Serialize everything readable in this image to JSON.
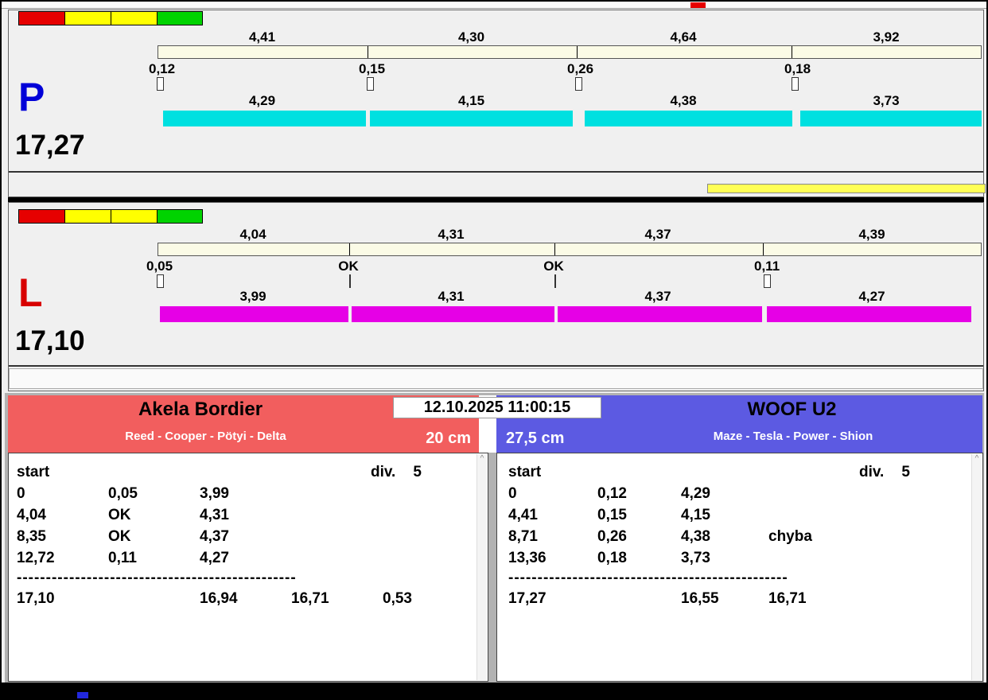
{
  "colors": {
    "lane_p_bar": "#00e0e0",
    "lane_l_bar": "#e600e6",
    "lane_p_letter": "#0000d8",
    "lane_l_letter": "#d80000",
    "team_left_header": "#f25e5e",
    "team_right_header": "#5c5ae2",
    "traffic_lights": [
      "#e60000",
      "#ffff00",
      "#ffff00",
      "#00d300"
    ],
    "progress_bar_yellow": "#ffff55"
  },
  "lanes": [
    {
      "letter": "P",
      "total": "17,27",
      "splits": [
        {
          "cum": "4,41",
          "start": "0,12",
          "leg": "4,29"
        },
        {
          "cum": "4,30",
          "start": "0,15",
          "leg": "4,15"
        },
        {
          "cum": "4,64",
          "start": "0,26",
          "leg": "4,38"
        },
        {
          "cum": "3,92",
          "start": "0,18",
          "leg": "3,73"
        }
      ]
    },
    {
      "letter": "L",
      "total": "17,10",
      "splits": [
        {
          "cum": "4,04",
          "start": "0,05",
          "leg": "3,99"
        },
        {
          "cum": "4,31",
          "start": "OK",
          "leg": "4,31"
        },
        {
          "cum": "4,37",
          "start": "OK",
          "leg": "4,37"
        },
        {
          "cum": "4,39",
          "start": "0,11",
          "leg": "4,27"
        }
      ]
    }
  ],
  "scoreboard": {
    "timestamp": "12.10.2025 11:00:15",
    "left": {
      "team": "Akela Bordier",
      "dogs": "Reed - Cooper - Pötyi - Delta",
      "height": "20 cm",
      "start_label": "start",
      "div_label": "div.",
      "div_value": "5",
      "rows": [
        [
          "0",
          "0,05",
          "3,99",
          ""
        ],
        [
          "4,04",
          "OK",
          "4,31",
          ""
        ],
        [
          "8,35",
          "OK",
          "4,37",
          ""
        ],
        [
          "12,72",
          "0,11",
          "4,27",
          ""
        ]
      ],
      "separator": "------------------------------------------------",
      "totals": [
        "17,10",
        "16,94",
        "16,71",
        "0,53"
      ]
    },
    "right": {
      "team": "WOOF U2",
      "dogs": "Maze - Tesla - Power - Shion",
      "height": "27,5 cm",
      "start_label": "start",
      "div_label": "div.",
      "div_value": "5",
      "rows": [
        [
          "0",
          "0,12",
          "4,29",
          ""
        ],
        [
          "4,41",
          "0,15",
          "4,15",
          ""
        ],
        [
          "8,71",
          "0,26",
          "4,38",
          "chyba"
        ],
        [
          "13,36",
          "0,18",
          "3,73",
          ""
        ]
      ],
      "separator": "------------------------------------------------",
      "totals": [
        "17,27",
        "16,55",
        "16,71",
        ""
      ]
    }
  }
}
